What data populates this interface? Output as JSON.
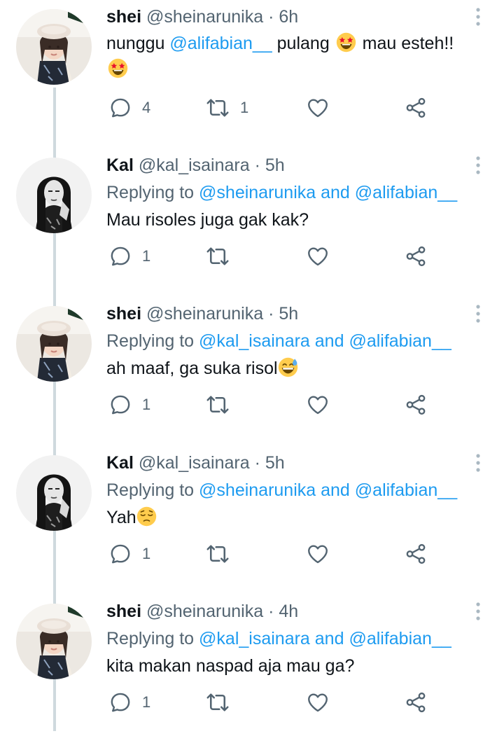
{
  "colors": {
    "text": "#0f1419",
    "secondary": "#536471",
    "link": "#1d9bf0",
    "thread_line": "#cfd9de"
  },
  "tweets": [
    {
      "name": "shei",
      "handle": "@sheinarunika",
      "separator": "·",
      "time": "6h",
      "avatar": "shei-avatar",
      "text_parts": {
        "t1": "nunggu ",
        "m1": "@alifabian__",
        "t2": " pulang ",
        "t3": " mau esteh!!"
      },
      "emojis": [
        "star-struck-emoji",
        "star-struck-emoji"
      ],
      "replies": "4",
      "retweets": "1"
    },
    {
      "name": "Kal",
      "handle": "@kal_isainara",
      "separator": "·",
      "time": "5h",
      "avatar": "kal-avatar",
      "replying": {
        "prefix": "Replying to ",
        "m1": "@sheinarunika",
        "and": " and ",
        "m2": "@alifabian__"
      },
      "text": "Mau risoles juga gak kak?",
      "replies": "1",
      "retweets": ""
    },
    {
      "name": "shei",
      "handle": "@sheinarunika",
      "separator": "·",
      "time": "5h",
      "avatar": "shei-avatar",
      "replying": {
        "prefix": "Replying to ",
        "m1": "@kal_isainara",
        "and": " and ",
        "m2": "@alifabian__"
      },
      "text": "ah maaf, ga suka risol",
      "emojis": [
        "grinning-sweat-emoji"
      ],
      "replies": "1",
      "retweets": ""
    },
    {
      "name": "Kal",
      "handle": "@kal_isainara",
      "separator": "·",
      "time": "5h",
      "avatar": "kal-avatar",
      "replying": {
        "prefix": "Replying to ",
        "m1": "@sheinarunika",
        "and": " and ",
        "m2": "@alifabian__"
      },
      "text": "Yah",
      "emojis": [
        "pensive-emoji"
      ],
      "replies": "1",
      "retweets": ""
    },
    {
      "name": "shei",
      "handle": "@sheinarunika",
      "separator": "·",
      "time": "4h",
      "avatar": "shei-avatar",
      "replying": {
        "prefix": "Replying to ",
        "m1": "@kal_isainara",
        "and": " and ",
        "m2": "@alifabian__"
      },
      "text": "kita makan naspad aja mau ga?",
      "replies": "1",
      "retweets": ""
    }
  ]
}
